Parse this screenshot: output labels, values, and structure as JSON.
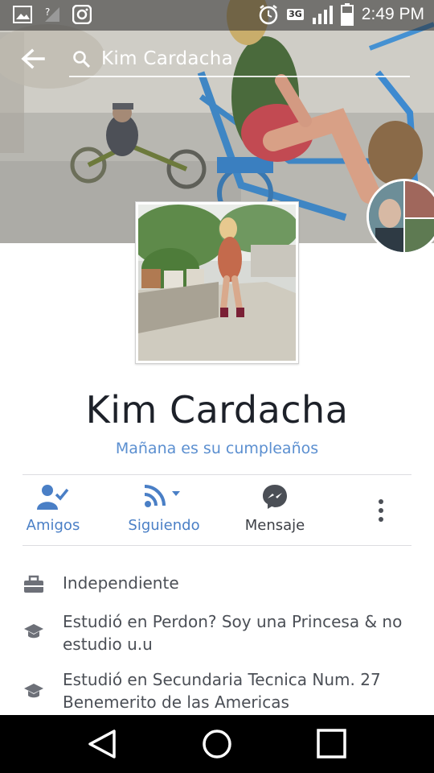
{
  "status_bar": {
    "time": "2:49 PM",
    "network": "3G",
    "left_icons": [
      "gallery-icon",
      "no-signal-icon",
      "instagram-icon"
    ],
    "right_icons": [
      "alarm-icon",
      "signal-icon",
      "battery-icon"
    ]
  },
  "header": {
    "search_text": "Kim Cardacha",
    "back_icon": "arrow-left-icon",
    "search_icon": "search-icon"
  },
  "profile": {
    "name": "Kim Cardacha",
    "birthday": "Mañana es su cumpleaños"
  },
  "actions": [
    {
      "label": "Amigos",
      "icon": "friends-check-icon",
      "color": "#4a7fc6"
    },
    {
      "label": "Siguiendo",
      "icon": "rss-follow-icon",
      "color": "#4a7fc6"
    },
    {
      "label": "Mensaje",
      "icon": "messenger-icon",
      "color": "#3c3f45"
    }
  ],
  "more_icon": "more-vertical-icon",
  "info": [
    {
      "icon": "briefcase-icon",
      "text": "Independiente"
    },
    {
      "icon": "graduation-cap-icon",
      "text": "Estudió en Perdon? Soy una Princesa & no estudio u.u"
    },
    {
      "icon": "graduation-cap-icon",
      "text": "Estudió en Secundaria Tecnica Num. 27 Benemerito de las Americas"
    }
  ],
  "nav_bar": [
    "back-triangle-icon",
    "home-circle-icon",
    "recents-square-icon"
  ],
  "colors": {
    "accent_blue": "#4a7fc6",
    "birthday_blue": "#5b8fd0",
    "text_dark": "#1d2129",
    "text_gray": "#4b4f56"
  }
}
